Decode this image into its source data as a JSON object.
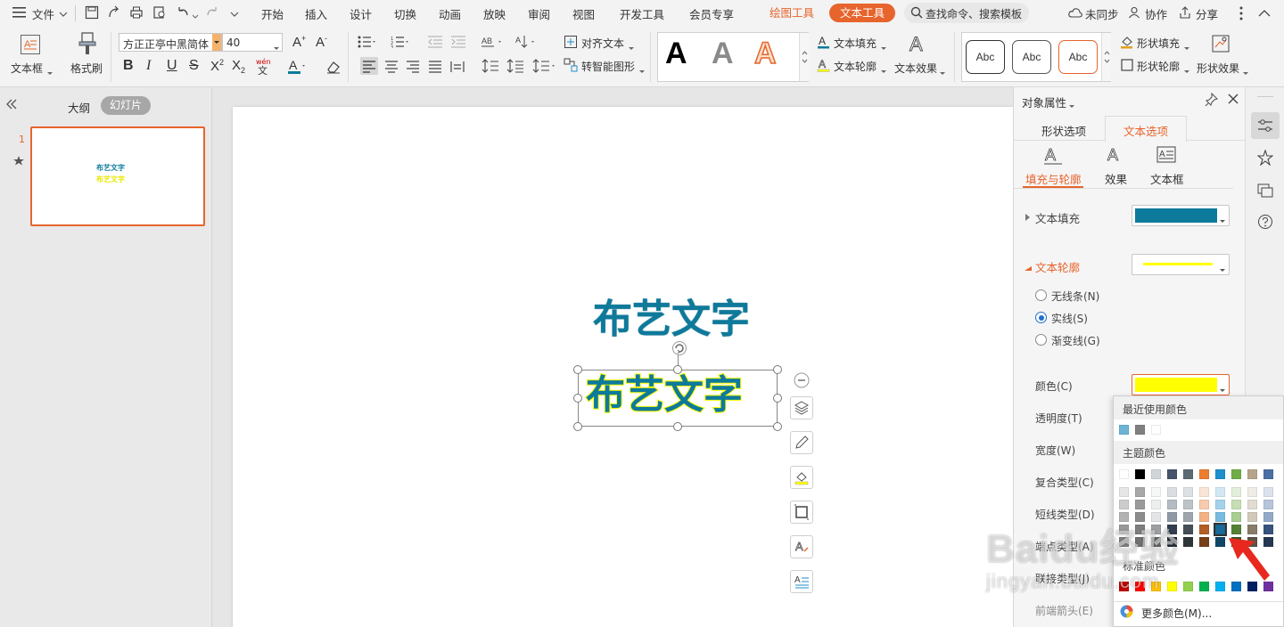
{
  "menubar": {
    "file": "文件",
    "tabs": [
      "开始",
      "插入",
      "设计",
      "切换",
      "动画",
      "放映",
      "审阅",
      "视图",
      "开发工具",
      "会员专享"
    ],
    "ctx_draw": "绘图工具",
    "ctx_text": "文本工具",
    "search": "查找命令、搜索模板",
    "unsync": "未同步",
    "collab": "协作",
    "share": "分享"
  },
  "ribbon": {
    "textbox": "文本框",
    "formatpainter": "格式刷",
    "font": "方正正亭中黑简体",
    "size": "40",
    "align_text": "对齐文本",
    "smartart": "转智能图形",
    "text_fill": "文本填充",
    "text_outline": "文本轮廓",
    "text_effect": "文本效果",
    "shape_fill": "形状填充",
    "shape_outline": "形状轮廓",
    "shape_effect": "形状效果",
    "abc": "Abc",
    "style_a": "A",
    "bold": "B",
    "italic": "I",
    "underline": "U",
    "strike": "S"
  },
  "leftpanel": {
    "outline_tab": "大纲",
    "slides_tab": "幻灯片",
    "slide_num": "1",
    "thumb_line1": "布艺文字",
    "thumb_line2": "布艺文字"
  },
  "slide": {
    "text1": "布艺文字",
    "text2": "布艺文字"
  },
  "rightpanel": {
    "title": "对象属性",
    "tab_shape": "形状选项",
    "tab_text": "文本选项",
    "sub_fill": "填充与轮廓",
    "sub_effect": "效果",
    "sub_textbox": "文本框",
    "text_fill": "文本填充",
    "text_outline": "文本轮廓",
    "no_line": "无线条(N)",
    "solid_line": "实线(S)",
    "gradient_line": "渐变线(G)",
    "color": "颜色(C)",
    "transparency": "透明度(T)",
    "width": "宽度(W)",
    "compound": "复合类型(C)",
    "dash": "短线类型(D)",
    "cap": "端点类型(A)",
    "join": "联接类型(J)",
    "arrow_begin": "前端箭头(E)"
  },
  "palette": {
    "recent": "最近使用颜色",
    "theme": "主题颜色",
    "standard": "标准颜色",
    "more": "更多颜色(M)...",
    "recent_colors": [
      "#6cb4d6",
      "#808080",
      "#ffffff"
    ],
    "theme_top": [
      "#ffffff",
      "#000000",
      "#d0d5d8",
      "#44546a",
      "#5b6b73",
      "#ed7d31",
      "#1f8ecd",
      "#70ad47",
      "#b5a58a",
      "#4a6fa5"
    ],
    "standard_colors": [
      "#c00000",
      "#ff0000",
      "#ffc000",
      "#ffff00",
      "#92d050",
      "#00b050",
      "#00b0f0",
      "#0070c0",
      "#002060",
      "#7030a0"
    ]
  },
  "colors": {
    "accent": "#e7642d",
    "fill": "#0e7a9b",
    "outline": "#ffff00"
  },
  "watermark": {
    "line1": "Baidu经验",
    "line2": "jingyan.baidu.com"
  }
}
